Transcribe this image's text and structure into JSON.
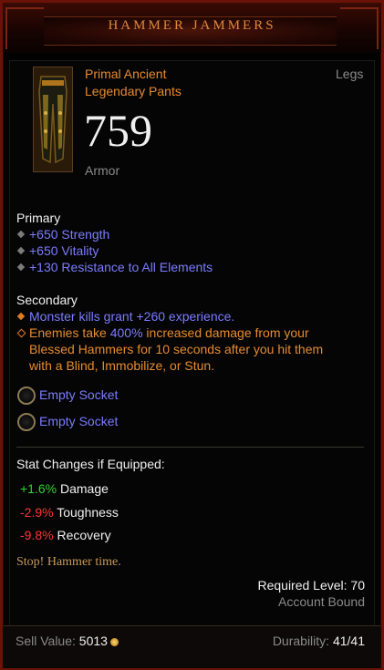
{
  "item": {
    "name": "HAMMER JAMMERS",
    "quality": "Primal Ancient",
    "kind": "Legendary Pants",
    "slot": "Legs",
    "armor_value": "759",
    "armor_label": "Armor",
    "icon": "pants-icon"
  },
  "primary": {
    "header": "Primary",
    "stats": [
      "+650 Strength",
      "+650 Vitality",
      "+130 Resistance to All Elements"
    ]
  },
  "secondary": {
    "header": "Secondary",
    "stat1": "Monster kills grant +260 experience.",
    "legendary_line1_pre": "Enemies take ",
    "legendary_line1_value": "400%",
    "legendary_line1_post": " increased damage from your",
    "legendary_line2": "Blessed Hammers for 10 seconds after you hit them",
    "legendary_line3": "with a Blind, Immobilize, or Stun."
  },
  "sockets": [
    "Empty Socket",
    "Empty Socket"
  ],
  "stat_changes": {
    "header": "Stat Changes if Equipped:",
    "rows": [
      {
        "value": "+1.6%",
        "label": "Damage",
        "color": "#2fd52f"
      },
      {
        "value": "-2.9%",
        "label": "Toughness",
        "color": "#ff3434"
      },
      {
        "value": "-9.8%",
        "label": "Recovery",
        "color": "#ff3434"
      }
    ]
  },
  "flavor": "Stop! Hammer time.",
  "requirements": {
    "required_level": "Required Level: 70",
    "binding": "Account Bound"
  },
  "footer": {
    "sell_label": "Sell Value:",
    "sell_value": "5013",
    "durability_label": "Durability:",
    "durability_value": "41/41"
  },
  "colors": {
    "border": "#6a1208",
    "title": "#e0873b",
    "legendary": "#e68a2e",
    "magic": "#7b7bff",
    "positive": "#2fd52f",
    "negative": "#ff3434"
  }
}
